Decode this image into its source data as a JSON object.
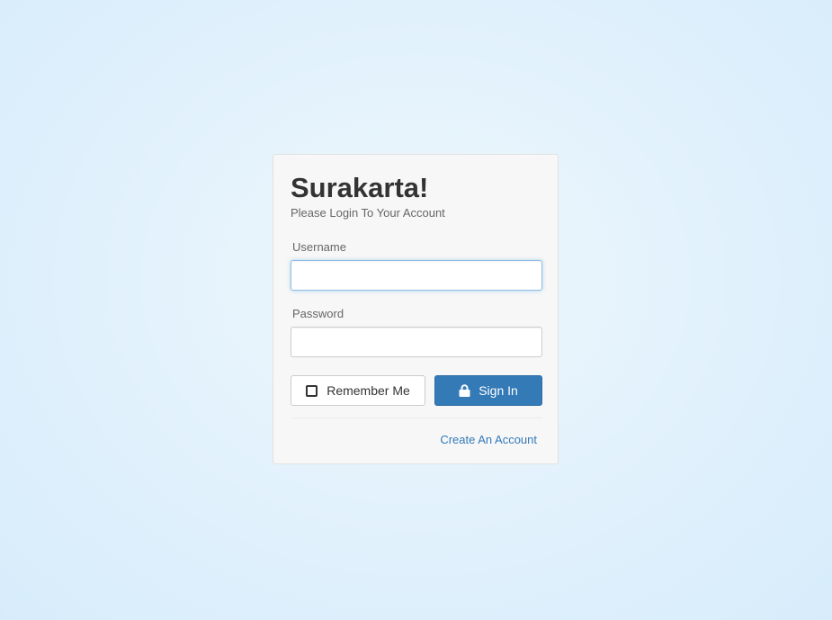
{
  "login": {
    "title": "Surakarta!",
    "subtitle": "Please Login To Your Account",
    "username": {
      "label": "Username",
      "value": "",
      "placeholder": ""
    },
    "password": {
      "label": "Password",
      "value": "",
      "placeholder": ""
    },
    "remember_label": "Remember Me",
    "remember_checked": false,
    "signin_label": "Sign In",
    "create_account_label": "Create An Account"
  },
  "icons": {
    "checkbox": "checkbox-unchecked-icon",
    "lock": "lock-icon"
  },
  "colors": {
    "accent": "#337ab7",
    "card_background": "#f7f7f7",
    "page_background": "#e3f2fc"
  }
}
